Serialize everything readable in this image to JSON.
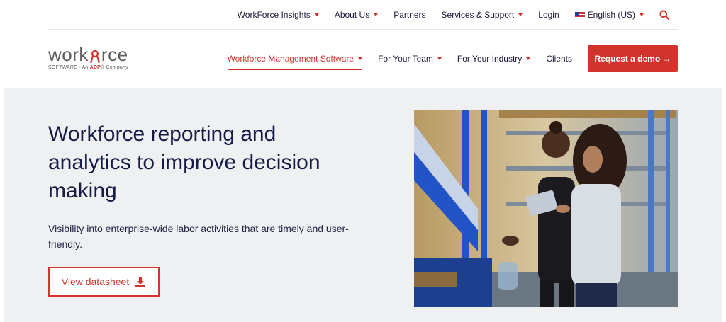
{
  "top_nav": {
    "items": [
      {
        "label": "WorkForce Insights",
        "dropdown": true
      },
      {
        "label": "About Us",
        "dropdown": true
      },
      {
        "label": "Partners",
        "dropdown": false
      },
      {
        "label": "Services & Support",
        "dropdown": true
      },
      {
        "label": "Login",
        "dropdown": false
      }
    ],
    "language": "English (US)",
    "search_icon": "search-icon"
  },
  "logo": {
    "wordmark": "workforce",
    "tagline_prefix": "SOFTWARE · An ",
    "tagline_adp": "ADP",
    "tagline_suffix": "® Company"
  },
  "main_nav": {
    "items": [
      {
        "label": "Workforce Management Software",
        "dropdown": true,
        "active": true
      },
      {
        "label": "For Your Team",
        "dropdown": true,
        "active": false
      },
      {
        "label": "For Your Industry",
        "dropdown": true,
        "active": false
      },
      {
        "label": "Clients",
        "dropdown": false,
        "active": false
      }
    ],
    "cta": "Request a demo →"
  },
  "hero": {
    "title": "Workforce reporting and analytics to improve decision making",
    "subtitle": "Visibility into enterprise-wide labor activities that are timely and user-friendly.",
    "button": "View datasheet",
    "button_icon": "download-icon"
  },
  "colors": {
    "accent": "#d0342c",
    "navy": "#151b45",
    "hero_bg": "#eef0f1"
  }
}
